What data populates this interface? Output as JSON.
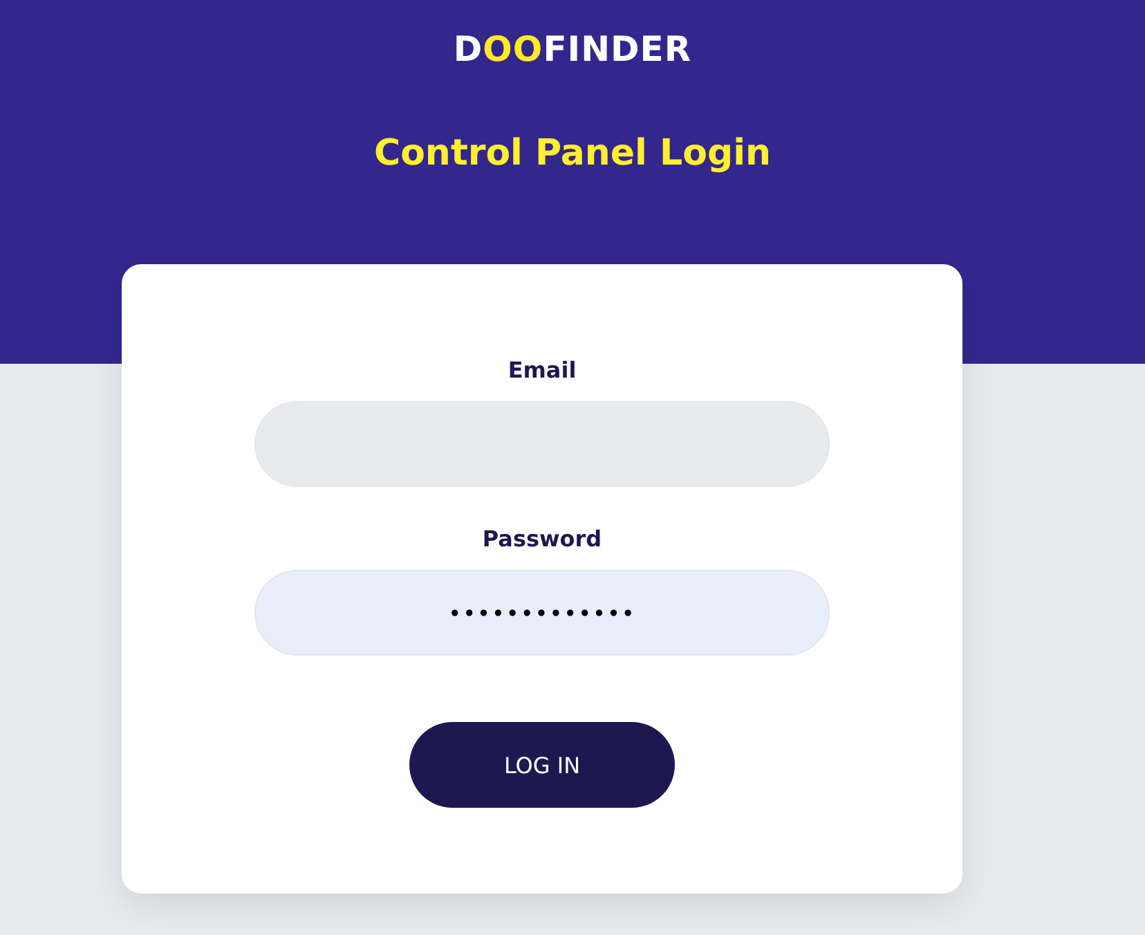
{
  "logo": {
    "start": "D",
    "highlight": "OO",
    "end": "FINDER"
  },
  "title": "Control Panel Login",
  "form": {
    "fields": [
      {
        "label": "Email",
        "focused": false
      },
      {
        "label": "Password",
        "value": "•••••••••••••",
        "focused": true
      }
    ],
    "submit": "LOG IN"
  }
}
